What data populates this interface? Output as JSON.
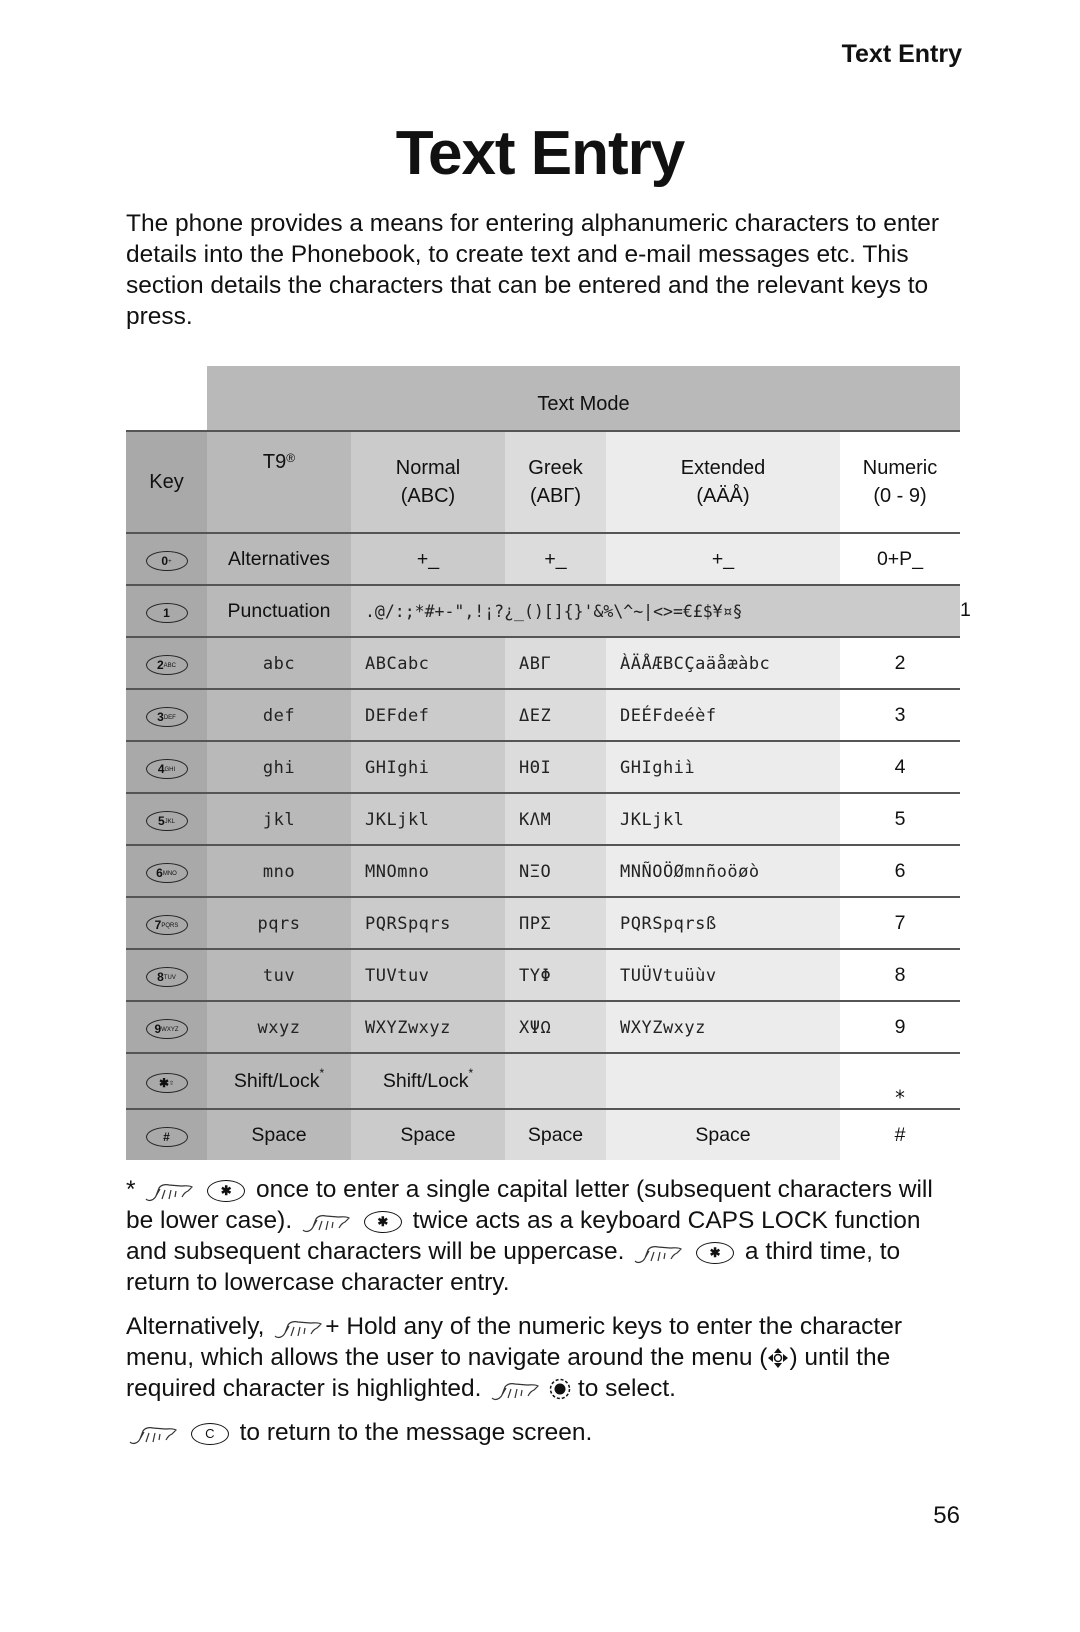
{
  "running_head": "Text Entry",
  "title": "Text Entry",
  "intro": "The phone provides a means for entering alphanumeric characters to enter details into the Phonebook, to create text and e-mail messages etc. This section details the characters that can be entered and the relevant keys to press.",
  "table": {
    "mode_header": "Text Mode",
    "columns": {
      "key": "Key",
      "t9": "T9",
      "t9_mark": "®",
      "normal": "Normal",
      "normal_sub": "(ABC)",
      "greek": "Greek",
      "greek_sub": "(ΑΒΓ)",
      "extended": "Extended",
      "extended_sub": "(AÄÅ)",
      "numeric": "Numeric",
      "numeric_sub": "(0 - 9)"
    },
    "rows": [
      {
        "key_digit": "0",
        "key_letters": "+",
        "t9": "Alternatives",
        "normal": "+_",
        "greek": "+_",
        "extended": "+_",
        "numeric": "0+P_"
      },
      {
        "key_digit": "1",
        "key_letters": "",
        "t9": "Punctuation",
        "punctuation": ".@/:;*#+-\",!¡?¿_()[]{}'&%\\^~|<>=€£$¥¤§",
        "numeric": "1"
      },
      {
        "key_digit": "2",
        "key_letters": "ABC",
        "t9": "abc",
        "normal": "ABCabc",
        "greek": "ΑΒΓ",
        "extended": "ÀÄÅÆBCÇaäåæàbc",
        "numeric": "2"
      },
      {
        "key_digit": "3",
        "key_letters": "DEF",
        "t9": "def",
        "normal": "DEFdef",
        "greek": "ΔΕΖ",
        "extended": "DEÉFdeéèf",
        "numeric": "3"
      },
      {
        "key_digit": "4",
        "key_letters": "GHI",
        "t9": "ghi",
        "normal": "GHIghi",
        "greek": "ΗΘΙ",
        "extended": "GHIghiì",
        "numeric": "4"
      },
      {
        "key_digit": "5",
        "key_letters": "JKL",
        "t9": "jkl",
        "normal": "JKLjkl",
        "greek": "ΚΛΜ",
        "extended": "JKLjkl",
        "numeric": "5"
      },
      {
        "key_digit": "6",
        "key_letters": "MNO",
        "t9": "mno",
        "normal": "MNOmno",
        "greek": "ΝΞΟ",
        "extended": "MNÑOÖØmnñoöøò",
        "numeric": "6"
      },
      {
        "key_digit": "7",
        "key_letters": "PQRS",
        "t9": "pqrs",
        "normal": "PQRSpqrs",
        "greek": "ΠΡΣ",
        "extended": "PQRSpqrsß",
        "numeric": "7"
      },
      {
        "key_digit": "8",
        "key_letters": "TUV",
        "t9": "tuv",
        "normal": "TUVtuv",
        "greek": "ΤΥΦ",
        "extended": "TUÜVtuüùv",
        "numeric": "8"
      },
      {
        "key_digit": "9",
        "key_letters": "WXYZ",
        "t9": "wxyz",
        "normal": "WXYZwxyz",
        "greek": "ΧΨΩ",
        "extended": "WXYZwxyz",
        "numeric": "9"
      },
      {
        "key_digit": "✱",
        "key_letters": "⇧",
        "t9": "Shift/Lock",
        "t9_mark": "*",
        "normal": "Shift/Lock",
        "normal_mark": "*",
        "greek": "",
        "extended": "",
        "numeric": "⁎"
      },
      {
        "key_digit": "#",
        "key_letters": "",
        "t9": "Space",
        "normal": "Space",
        "greek": "Space",
        "extended": "Space",
        "numeric": "#"
      }
    ]
  },
  "notes": {
    "asterisk": "*",
    "p1_a": "once to enter a single capital letter (subsequent characters will be lower case).",
    "p1_b": "twice acts as a keyboard CAPS LOCK function and subsequent characters will be uppercase.",
    "p1_c": "a third time, to return to lowercase character entry.",
    "p2_a": "Alternatively,",
    "p2_b": "+ Hold any of the numeric keys to enter the character menu, which allows the user to navigate around the menu (",
    "p2_c": ") until the required character is highlighted.",
    "p2_d": "to select.",
    "p3": "to return to the message screen.",
    "star_key_label": "✱",
    "clear_key_label": "C"
  },
  "page_number": "56"
}
